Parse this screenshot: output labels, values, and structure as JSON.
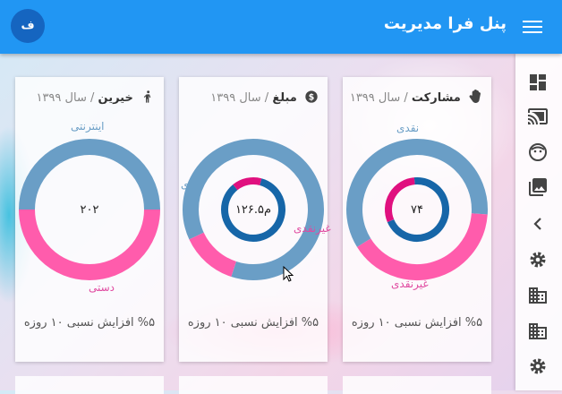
{
  "header": {
    "title": "پنل فرا مدیریت",
    "avatar_letter": "ف"
  },
  "sidebar": {
    "items": [
      {
        "icon": "dashboard-icon"
      },
      {
        "icon": "cast-icon"
      },
      {
        "icon": "face-icon"
      },
      {
        "icon": "photo-library-icon"
      },
      {
        "icon": "chevron-left-icon"
      },
      {
        "icon": "settings-icon"
      },
      {
        "icon": "business-icon"
      },
      {
        "icon": "business-icon"
      },
      {
        "icon": "settings-icon"
      }
    ]
  },
  "cards": [
    {
      "title": "مشارکت",
      "separator": "/",
      "year": "سال ۱۳۹۹",
      "icon": "hand-icon",
      "center": "۷۴",
      "labels": {
        "outer_top": "نقدی",
        "outer_bottom": "غیرنقدی"
      },
      "footer": "%۵ افزایش نسبی ۱۰ روزه"
    },
    {
      "title": "مبلغ",
      "separator": "/",
      "year": "سال ۱۳۹۹",
      "icon": "dollar-icon",
      "center": "۱۲۶.۵م",
      "labels": {
        "outer_top": "نقدی",
        "outer_bottom": "غیرنقدی"
      },
      "footer": "%۵ افزایش نسبی ۱۰ روزه"
    },
    {
      "title": "خیرین",
      "separator": "/",
      "year": "سال ۱۳۹۹",
      "icon": "person-icon",
      "center": "۲۰۲",
      "labels": {
        "outer_top": "اینترنتی",
        "outer_bottom": "دستی"
      },
      "footer": "%۵ افزایش نسبی ۱۰ روزه"
    }
  ],
  "colors": {
    "appbar": "#2196f3",
    "ring_blue": "#6a9ec6",
    "ring_pink": "#ff5cac",
    "inner_blue": "#1666a8",
    "inner_pink": "#e0107f"
  },
  "chart_data": [
    {
      "type": "pie",
      "title": "مشارکت",
      "center_label": "۷۴",
      "series": [
        {
          "categories": [
            "نقدی",
            "غیرنقدی"
          ],
          "values": [
            0.6,
            0.4
          ]
        },
        {
          "categories": [
            "نقدی",
            "غیرنقدی"
          ],
          "values": [
            0.7,
            0.3
          ]
        }
      ]
    },
    {
      "type": "pie",
      "title": "مبلغ",
      "center_label": "۱۲۶.۵م",
      "series": [
        {
          "categories": [
            "نقدی",
            "غیرنقدی"
          ],
          "values": [
            0.87,
            0.13
          ]
        },
        {
          "categories": [
            "نقدی",
            "غیرنقدی"
          ],
          "values": [
            0.85,
            0.15
          ]
        }
      ]
    },
    {
      "type": "pie",
      "title": "خیرین",
      "center_label": "۲۰۲",
      "series": [
        {
          "categories": [
            "اینترنتی",
            "دستی"
          ],
          "values": [
            0.5,
            0.5
          ]
        }
      ]
    }
  ]
}
